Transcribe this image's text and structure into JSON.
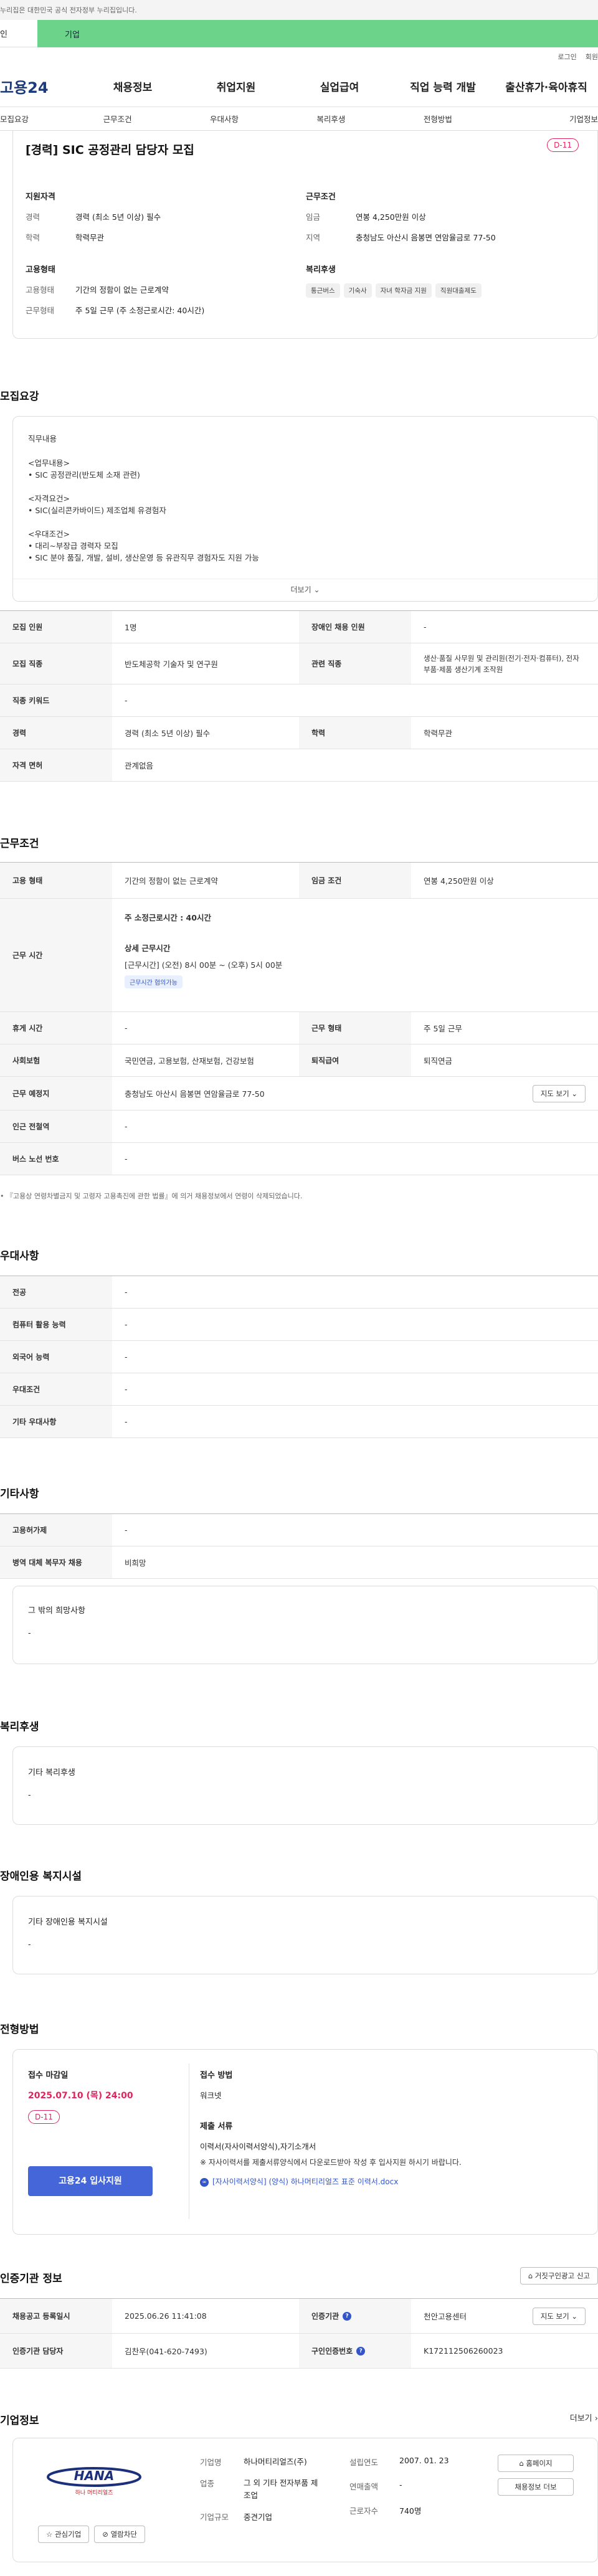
{
  "gov_notice": "누리집은 대한민국 공식 전자정부 누리집입니다.",
  "user_tabs": {
    "person": "인",
    "business": "기업"
  },
  "util": {
    "login": "로그인",
    "join": "회원"
  },
  "gnb": {
    "logo": "고용24",
    "items": [
      "채용정보",
      "취업지원",
      "실업급여",
      "직업 능력 개발",
      "출산휴가·육아휴직"
    ]
  },
  "subnav": [
    "모집요강",
    "근무조건",
    "우대사항",
    "복리후생",
    "전형방법",
    "기업정보"
  ],
  "summary": {
    "title": "[경력] SIC 공정관리 담당자 모집",
    "dday": "D-11",
    "qual_title": "지원자격",
    "qual": [
      {
        "k": "경력",
        "v": "경력 (최소 5년 이상) 필수"
      },
      {
        "k": "학력",
        "v": "학력무관"
      }
    ],
    "cond_title": "근무조건",
    "cond": [
      {
        "k": "임금",
        "v": "연봉 4,250만원 이상"
      },
      {
        "k": "지역",
        "v": "충청남도 아산시 음봉면 연암율금로 77-50"
      }
    ],
    "emp_title": "고용형태",
    "emp": [
      {
        "k": "고용형태",
        "v": "기간의 정함이 없는 근로계약"
      },
      {
        "k": "근무형태",
        "v": "주 5일 근무 (주 소정근로시간: 40시간)"
      }
    ],
    "welfare_title": "복리후생",
    "welfare_badges": [
      "통근버스",
      "기숙사",
      "자녀 학자금 지원",
      "직원대출제도"
    ]
  },
  "recruit": {
    "section_title": "모집요강",
    "detail_label": "직무내용",
    "detail_text": "<업무내용>\n• SIC 공정관리(반도체 소재 관련)\n\n<자격요건>\n• SIC(실리콘카바이드) 제조업체 유경험자\n\n<우대조건>\n• 대리~부장급 경력자 모집\n• SIC 분야 품질, 개발, 설비, 생산운영 등 유관직무 경험자도 지원 가능",
    "more": "더보기",
    "rows": [
      {
        "k1": "모집 인원",
        "v1": "1명",
        "k2": "장애인 채용 인원",
        "v2": "-"
      },
      {
        "k1": "모집 직종",
        "v1": "반도체공학 기술자 및 연구원",
        "k2": "관련 직종",
        "v2": "생산·품질 사무원 및 관리원(전기·전자·컴퓨터), 전자 부품·제품 생산기계 조작원"
      },
      {
        "k1": "직종 키워드",
        "v1": "-"
      },
      {
        "k1": "경력",
        "v1": "경력 (최소 5년 이상) 필수",
        "k2": "학력",
        "v2": "학력무관"
      },
      {
        "k1": "자격 면허",
        "v1": "관계없음"
      }
    ]
  },
  "work": {
    "section_title": "근무조건",
    "emp_type_k": "고용 형태",
    "emp_type_v": "기간의 정함이 없는 근로계약",
    "wage_k": "임금 조건",
    "wage_v": "연봉 4,250만원 이상",
    "hours_k": "근무 시간",
    "hours_main": "주 소정근로시간 : 40시간",
    "hours_detail_title": "상세 근무시간",
    "hours_detail": "[근무시간] (오전) 8시 00분 ~ (오후) 5시 00분",
    "hours_pill": "근무시간 협의가능",
    "rest_k": "휴게 시간",
    "rest_v": "-",
    "form_k": "근무 형태",
    "form_v": "주 5일 근무",
    "ins_k": "사회보험",
    "ins_v": "국민연금, 고용보험, 산재보험, 건강보험",
    "sev_k": "퇴직급여",
    "sev_v": "퇴직연금",
    "place_k": "근무 예정지",
    "place_v": "충청남도 아산시 음봉면 연암율금로 77-50",
    "map_btn": "지도 보기",
    "subway_k": "인근 전철역",
    "subway_v": "-",
    "bus_k": "버스 노선 번호",
    "bus_v": "-",
    "note": "• 『고용상 연령차별금지 및 고령자 고용촉진에 관한 법률』에 의거 채용정보에서 연령이 삭제되었습니다."
  },
  "pref": {
    "section_title": "우대사항",
    "rows": [
      {
        "k": "전공",
        "v": "-"
      },
      {
        "k": "컴퓨터 활용 능력",
        "v": "-"
      },
      {
        "k": "외국어 능력",
        "v": "-"
      },
      {
        "k": "우대조건",
        "v": "-"
      },
      {
        "k": "기타 우대사항",
        "v": "-"
      }
    ]
  },
  "etc": {
    "section_title": "기타사항",
    "rows": [
      {
        "k": "고용허가제",
        "v": "-"
      },
      {
        "k": "병역 대체 복무자 채용",
        "v": "비희망"
      }
    ],
    "other_title": "그 밖의 희망사항",
    "other_value": "-"
  },
  "welfare": {
    "section_title": "복리후생",
    "box_title": "기타 복리후생",
    "box_value": "-"
  },
  "disabled": {
    "section_title": "장애인용 복지시설",
    "box_title": "기타 장애인용 복지시설",
    "box_value": "-"
  },
  "process": {
    "section_title": "전형방법",
    "deadline_label": "접수 마감일",
    "deadline": "2025.07.10 (목) 24:00",
    "dday": "D-11",
    "apply_btn": "고용24 입사지원",
    "method_label": "접수 방법",
    "method_value": "워크넷",
    "docs_label": "제출 서류",
    "docs_value": "이력서(자사이력서양식),자기소개서",
    "docs_note": "※ 자사이력서를 제출서류양식에서 다운로드받아 작성 후 입사지원 하시기 바랍니다.",
    "docs_file": "[자사이력서양식] (양식) 하나머티리얼즈 표준 이력서.docx"
  },
  "cert": {
    "section_title": "인증기관 정보",
    "report_btn": "거짓구인광고 신고",
    "reg_k": "채용공고 등록일시",
    "reg_v": "2025.06.26 11:41:08",
    "org_k": "인증기관",
    "org_v": "천안고용센터",
    "map_btn": "지도 보기",
    "mgr_k": "인증기관 담당자",
    "mgr_v": "김찬우(041-620-7493)",
    "num_k": "구인인증번호",
    "num_v": "K172112506260023"
  },
  "company": {
    "section_title": "기업정보",
    "more": "더보기",
    "logo_text": "HANA",
    "logo_sub": "하나 머티리얼즈",
    "fav_btn": "관심기업",
    "block_btn": "열람차단",
    "name_k": "기업명",
    "name_v": "하나머티리얼즈(주)",
    "ind_k": "업종",
    "ind_v": "그 외 기타 전자부품 제조업",
    "size_k": "기업규모",
    "size_v": "중견기업",
    "est_k": "설립연도",
    "est_v": "2007. 01. 23",
    "sales_k": "연매출액",
    "sales_v": "-",
    "emp_k": "근로자수",
    "emp_v": "740명",
    "home_btn": "홈페이지",
    "list_btn": "채용정보 더보"
  }
}
